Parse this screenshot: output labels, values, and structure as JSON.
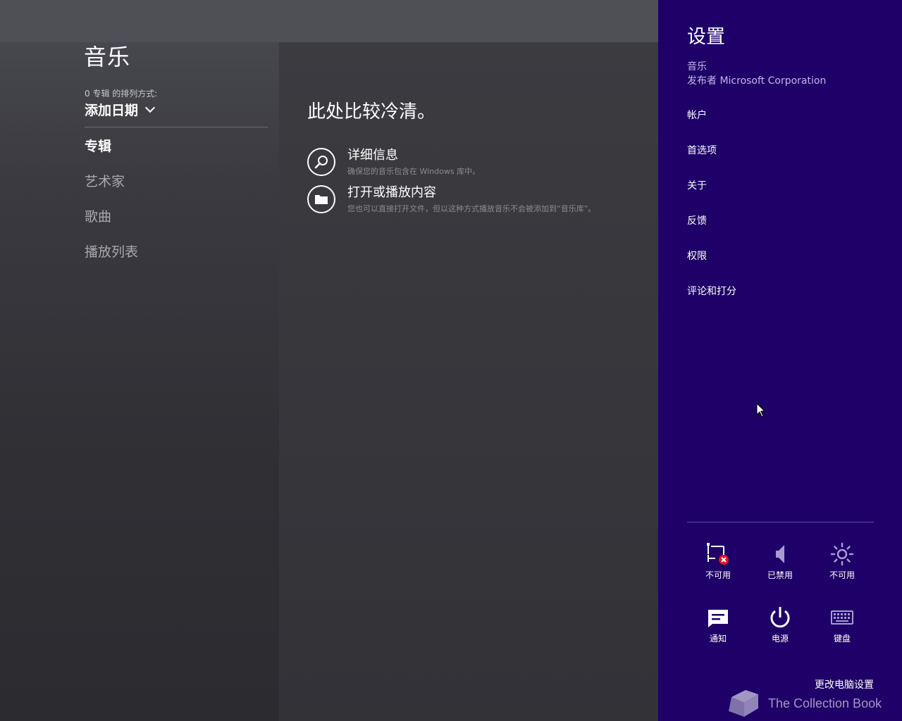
{
  "app": {
    "title": "音乐",
    "sort_caption": "0 专辑 的排列方式:",
    "sort_value": "添加日期",
    "nav": [
      {
        "label": "专辑",
        "active": true
      },
      {
        "label": "艺术家",
        "active": false
      },
      {
        "label": "歌曲",
        "active": false
      },
      {
        "label": "播放列表",
        "active": false
      }
    ]
  },
  "content": {
    "empty_title": "此处比较冷清。",
    "actions": [
      {
        "title": "详细信息",
        "subtitle": "确保您的音乐包含在 Windows 库中。",
        "icon": "search-icon"
      },
      {
        "title": "打开或播放内容",
        "subtitle": "您也可以直接打开文件，但以这种方式播放音乐不会被添加到“音乐库”。",
        "icon": "folder-icon"
      }
    ]
  },
  "charm": {
    "title": "设置",
    "app_name": "音乐",
    "publisher": "发布者 Microsoft Corporation",
    "items": [
      "帐户",
      "首选项",
      "关于",
      "反馈",
      "权限",
      "评论和打分"
    ],
    "quick": [
      {
        "label": "不可用",
        "icon": "network-unavailable-icon"
      },
      {
        "label": "已禁用",
        "icon": "volume-icon"
      },
      {
        "label": "不可用",
        "icon": "brightness-icon"
      },
      {
        "label": "通知",
        "icon": "notifications-icon"
      },
      {
        "label": "电源",
        "icon": "power-icon"
      },
      {
        "label": "键盘",
        "icon": "keyboard-icon"
      }
    ],
    "change_pc_settings": "更改电脑设置"
  },
  "watermark": "The Collection Book",
  "colors": {
    "charm_bg": "#1e0068",
    "app_bg": "#333338"
  }
}
